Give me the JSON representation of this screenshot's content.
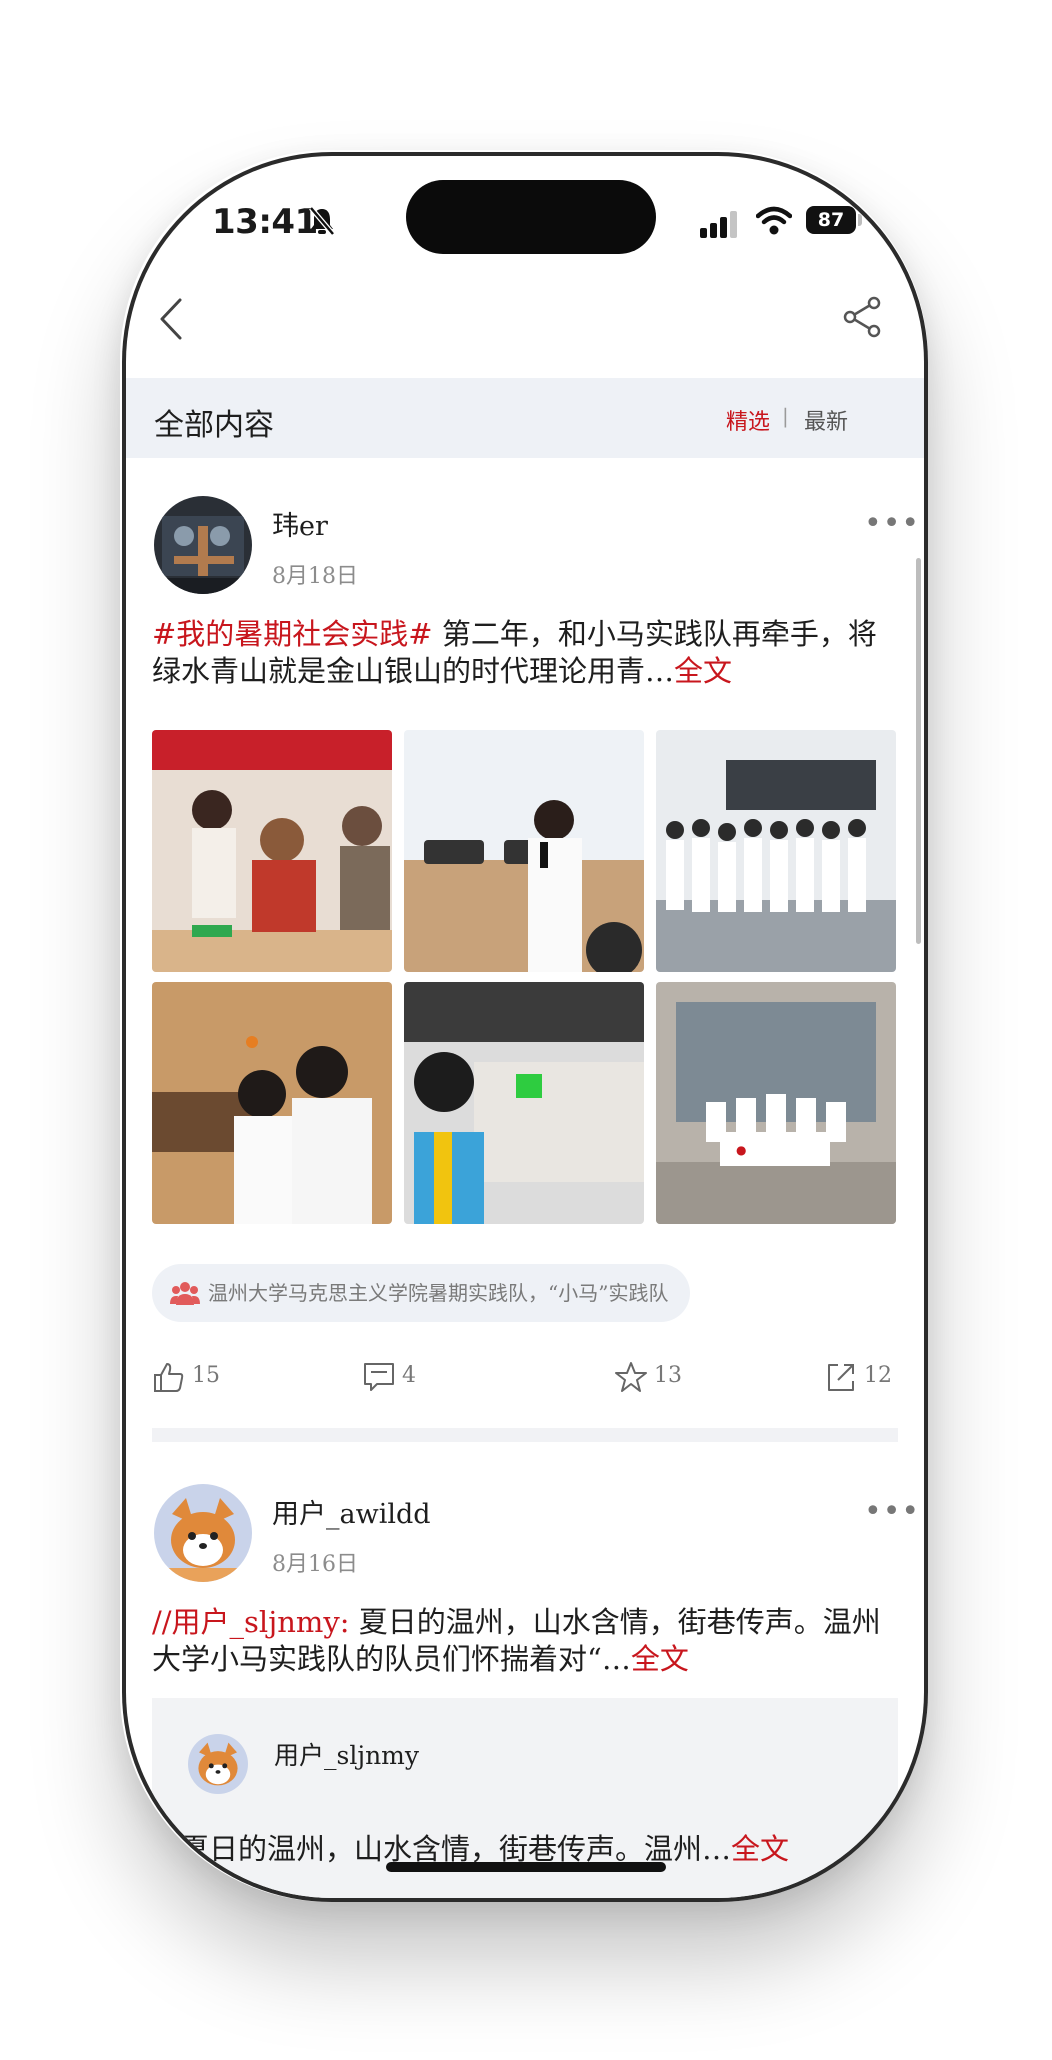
{
  "status_bar": {
    "time": "13:41",
    "battery": "87"
  },
  "header": {
    "section_title": "全部内容",
    "filter_featured": "精选",
    "filter_divider": "|",
    "filter_latest": "最新"
  },
  "colors": {
    "accent_red": "#c8161d",
    "section_bg": "#eef1f6"
  },
  "post1": {
    "username": "玮er",
    "date": "8月18日",
    "topic": "#我的暑期社会实践#",
    "text": "  第二年，和小马实践队再牵手，将绿水青山就是金山银山的时代理论用青…",
    "fulltext_label": "全文",
    "team_tag": "温州大学马克思主义学院暑期实践队，“小马”实践队",
    "likes": "15",
    "comments": "4",
    "favorites": "13",
    "shares": "12"
  },
  "post2": {
    "username": "用户_awildd",
    "date": "8月16日",
    "mention": "//用户_sljnmy:",
    "text": "  夏日的温州，山水含情，街巷传声。温州大学小马实践队的队员们怀揣着对“…",
    "fulltext_label": "全文",
    "quoted_username": "用户_sljnmy",
    "quoted_text": "夏日的温州，山水含情，街巷传声。温州…",
    "quoted_fulltext_label": "全文"
  },
  "icons": [
    "bell-off-icon",
    "signal-icon",
    "wifi-icon",
    "back-icon",
    "share-icon",
    "more-icon",
    "team-icon",
    "thumbs-up-icon",
    "comment-icon",
    "star-icon",
    "forward-icon"
  ]
}
